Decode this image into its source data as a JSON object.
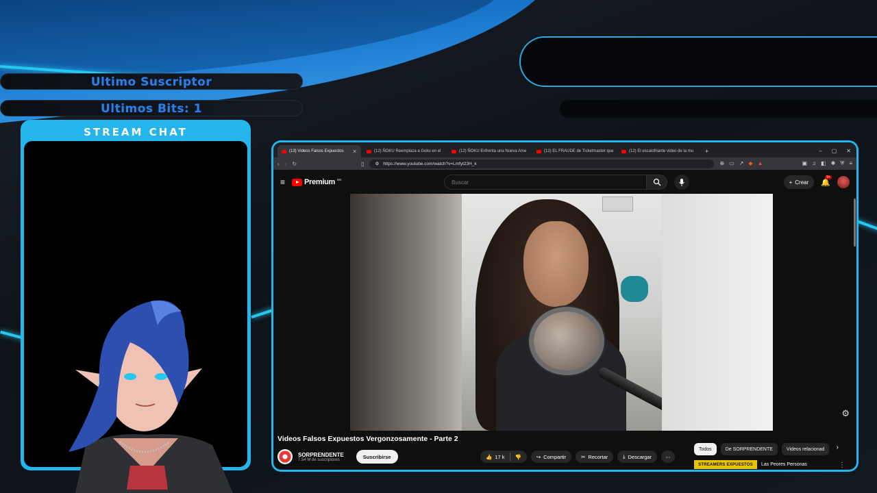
{
  "overlay": {
    "last_subscriber_label": "Ultimo Suscriptor",
    "last_bits_label": "Ultimos Bits: 1",
    "chat_title": "STREAM CHAT",
    "accent_color": "#27c7f0"
  },
  "browser": {
    "tabs": [
      {
        "label": "(13) Videos Falsos Expuestos",
        "active": true
      },
      {
        "label": "(12) ÑOKU Reemplaza a Goku en el",
        "active": false
      },
      {
        "label": "(12) ÑOKU Enfrenta una Nueva Ame",
        "active": false
      },
      {
        "label": "(12) EL FRAUDE de Ticketmaster que",
        "active": false
      },
      {
        "label": "(12) El escalofriante video de la mu",
        "active": false
      }
    ],
    "new_tab_icon": "+",
    "url": "https://www.youtube.com/watch?v=Lmfyt23H_k",
    "window_controls": [
      "–",
      "▢",
      "✕"
    ]
  },
  "youtube": {
    "logo_text": "Premium",
    "region": "MX",
    "search_placeholder": "Buscar",
    "create_label": "Crear",
    "notif_count": "9+",
    "video_title": "Videos Falsos Expuestos Vergonzosamente - Parte 2",
    "channel_name": "SORPRENDENTE",
    "channel_subs": "7.54 M de suscriptores",
    "subscribe_label": "Suscribirse",
    "likes": "17 k",
    "share_label": "Compartir",
    "clip_label": "Recortar",
    "download_label": "Descargar",
    "chips": [
      "Todos",
      "De SORPRENDENTE",
      "Videos relacionad"
    ],
    "rec_thumb_text": "STREAMERS EXPUESTOS",
    "rec_title": "Las Peores Personas"
  }
}
